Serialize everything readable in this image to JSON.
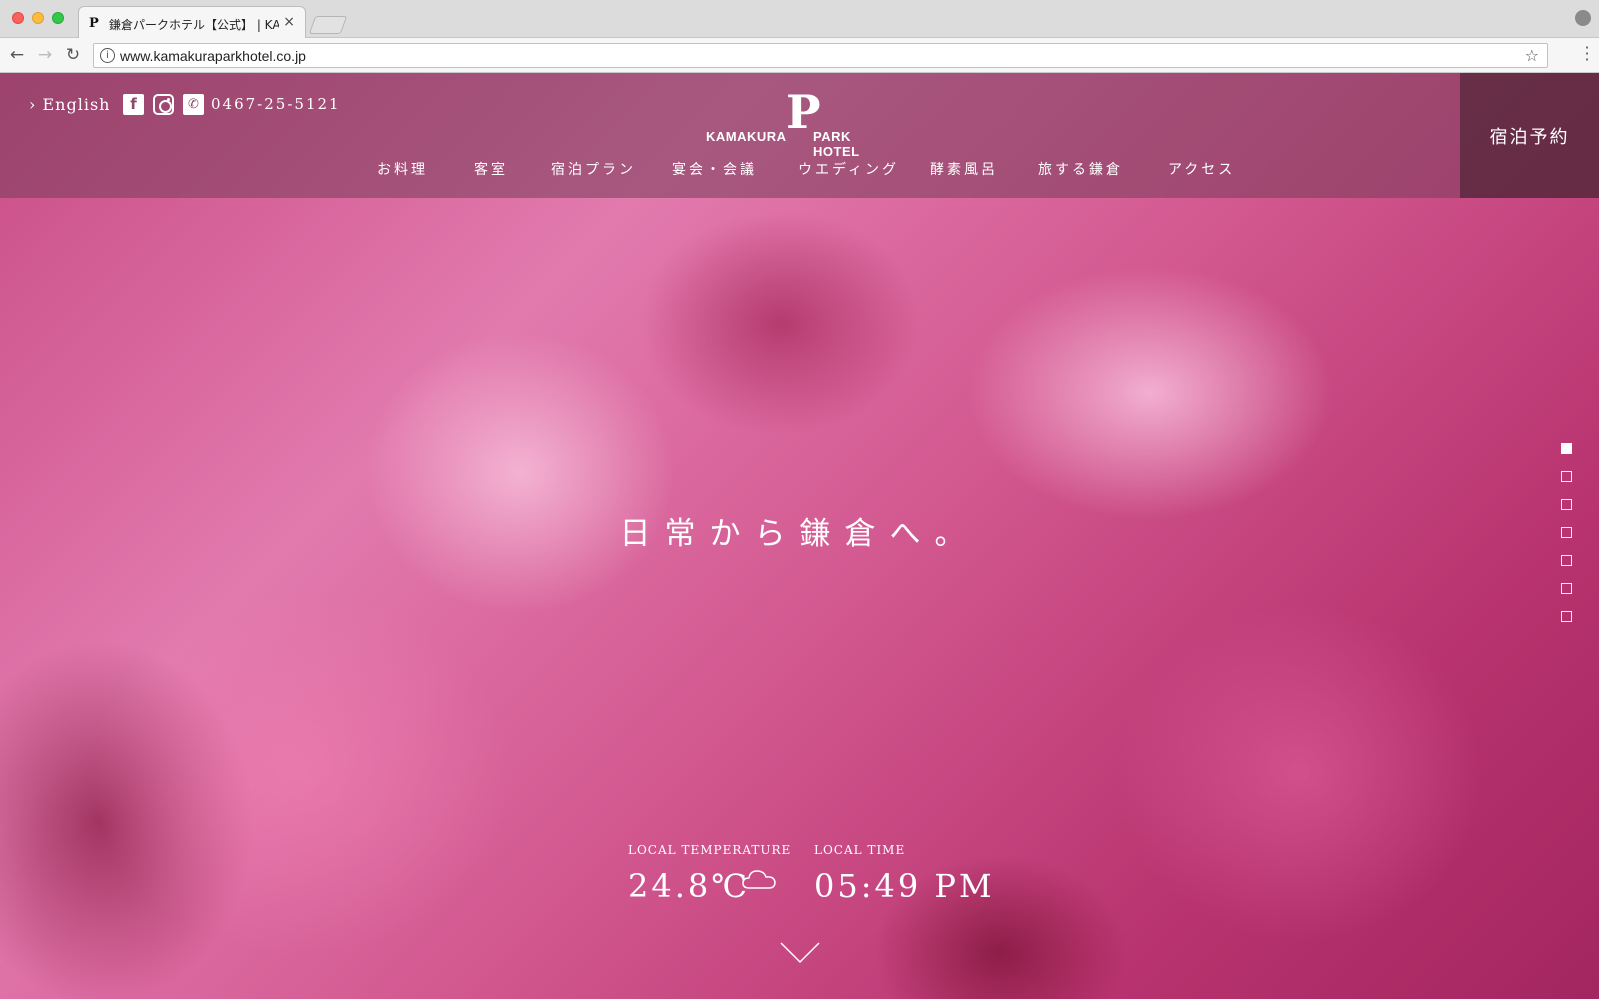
{
  "browser": {
    "tab_favicon": "P",
    "tab_title": "鎌倉パークホテル【公式】 | KAMAKURA",
    "tab_close": "×",
    "url": "www.kamakuraparkhotel.co.jp",
    "icons": [
      "back-arrow-icon",
      "forward-arrow-icon",
      "reload-icon",
      "info-icon",
      "star-icon",
      "menu-icon",
      "profile-icon"
    ]
  },
  "header": {
    "language_link": "› English",
    "social_icons": [
      "facebook-icon",
      "instagram-icon",
      "phone-icon"
    ],
    "phone": "0467-25-5121",
    "logo": {
      "mark": "P",
      "left_text": "KAMAKURA",
      "right_text": "PARK HOTEL"
    },
    "nav": [
      "お料理",
      "客室",
      "宿泊プラン",
      "宴会・会議",
      "ウエディング",
      "酵素風呂",
      "旅する鎌倉",
      "アクセス"
    ],
    "reserve_label": "宿泊予約"
  },
  "hero": {
    "catchphrase": "日常から鎌倉へ。",
    "slide_count": 7,
    "active_slide": 1,
    "scroll_icon": "chevron-down-icon"
  },
  "info": {
    "temperature_label": "LOCAL TEMPERATURE",
    "temperature_value": "24.8℃",
    "weather_icon": "cloud-icon",
    "time_label": "LOCAL TIME",
    "time_value": "05:49 PM"
  },
  "colors": {
    "header_band": "#7a3c5a",
    "reserve_panel": "#462332",
    "text": "#ffffff"
  }
}
